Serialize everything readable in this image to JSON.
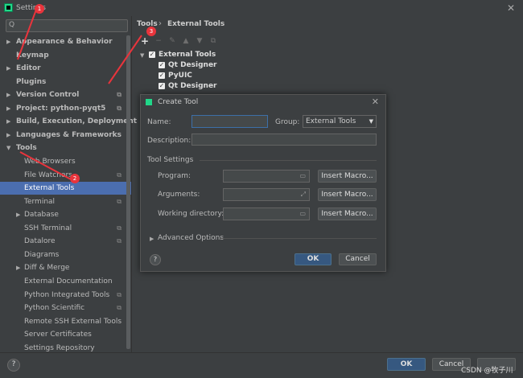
{
  "window": {
    "title": "Settings",
    "close": "✕"
  },
  "sidebar": {
    "search_icon": "Q",
    "items": [
      {
        "label": "Appearance & Behavior"
      },
      {
        "label": "Keymap"
      },
      {
        "label": "Editor"
      },
      {
        "label": "Plugins"
      },
      {
        "label": "Version Control"
      },
      {
        "label": "Project: python-pyqt5"
      },
      {
        "label": "Build, Execution, Deployment"
      },
      {
        "label": "Languages & Frameworks"
      },
      {
        "label": "Tools"
      },
      {
        "label": "Web Browsers"
      },
      {
        "label": "File Watchers"
      },
      {
        "label": "External Tools"
      },
      {
        "label": "Terminal"
      },
      {
        "label": "Database"
      },
      {
        "label": "SSH Terminal"
      },
      {
        "label": "Datalore"
      },
      {
        "label": "Diagrams"
      },
      {
        "label": "Diff & Merge"
      },
      {
        "label": "External Documentation"
      },
      {
        "label": "Python Integrated Tools"
      },
      {
        "label": "Python Scientific"
      },
      {
        "label": "Remote SSH External Tools"
      },
      {
        "label": "Server Certificates"
      },
      {
        "label": "Settings Repository"
      }
    ]
  },
  "breadcrumb": {
    "parent": "Tools",
    "separator": "›",
    "current": "External Tools"
  },
  "toolbar": {
    "add": "+",
    "remove": "−",
    "edit": "✎",
    "up": "▲",
    "down": "▼",
    "copy": "⧉"
  },
  "tools_tree": {
    "group": "External Tools",
    "items": [
      "Qt Designer",
      "PyUIC",
      "Qt Designer"
    ],
    "check": "✓"
  },
  "dialog": {
    "title": "Create Tool",
    "name_label": "Name:",
    "name_value": "",
    "group_label": "Group:",
    "group_value": "External Tools",
    "description_label": "Description:",
    "tool_settings_label": "Tool Settings",
    "program_label": "Program:",
    "arguments_label": "Arguments:",
    "working_dir_label": "Working directory:",
    "insert_macro": "Insert Macro...",
    "advanced_label": "Advanced Options",
    "help": "?",
    "ok": "OK",
    "cancel": "Cancel"
  },
  "footer": {
    "help": "?",
    "ok": "OK",
    "cancel": "Cancel"
  },
  "watermark": "CSDN @牧子川",
  "annotations": [
    "1",
    "2",
    "3"
  ],
  "colors": {
    "accent": "#4b6eaf",
    "ok_button": "#365880",
    "annotation": "#e9343c"
  }
}
